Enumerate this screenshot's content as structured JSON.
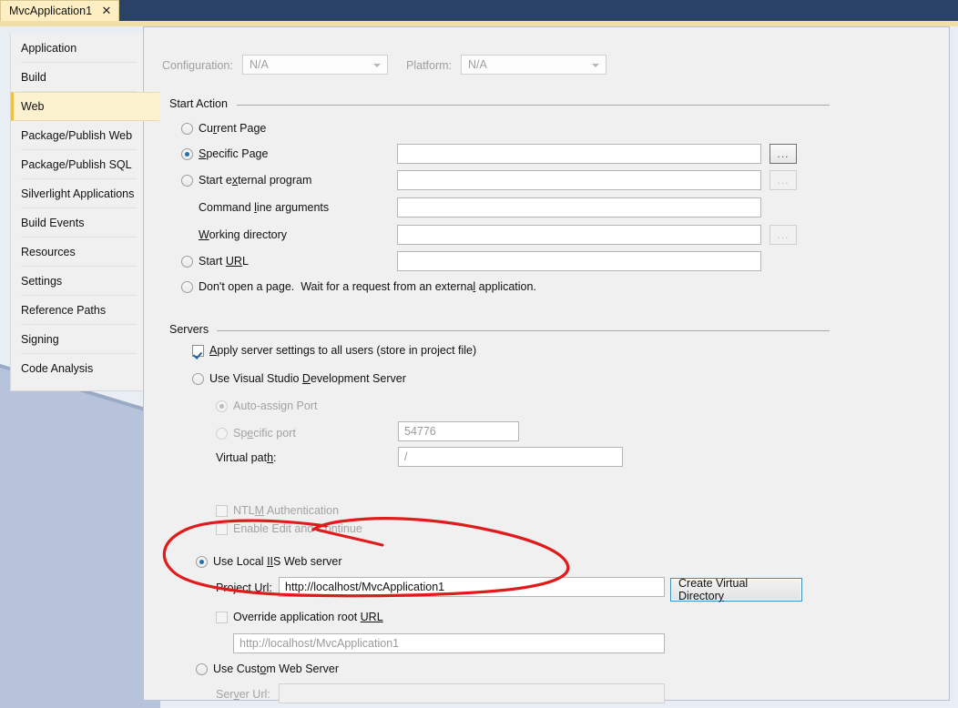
{
  "window": {
    "tab_label": "MvcApplication1",
    "close_icon": "close-icon",
    "accent_tab_bg": "#fdeec3",
    "titlebar_bg": "#2b4268"
  },
  "sidebar": {
    "items": [
      {
        "label": "Application",
        "selected": false
      },
      {
        "label": "Build",
        "selected": false
      },
      {
        "label": "Web",
        "selected": true
      },
      {
        "label": "Package/Publish Web",
        "selected": false
      },
      {
        "label": "Package/Publish SQL",
        "selected": false
      },
      {
        "label": "Silverlight Applications",
        "selected": false
      },
      {
        "label": "Build Events",
        "selected": false
      },
      {
        "label": "Resources",
        "selected": false
      },
      {
        "label": "Settings",
        "selected": false
      },
      {
        "label": "Reference Paths",
        "selected": false
      },
      {
        "label": "Signing",
        "selected": false
      },
      {
        "label": "Code Analysis",
        "selected": false
      }
    ]
  },
  "config_bar": {
    "configuration_label": "Configuration:",
    "configuration_value": "N/A",
    "platform_label": "Platform:",
    "platform_value": "N/A",
    "dropdown_icon": "chevron-down-icon"
  },
  "start_action": {
    "group_title": "Start Action",
    "options": [
      {
        "id": "current-page",
        "label": "Current Page",
        "mnemonic": "r",
        "selected": false,
        "disabled": false
      },
      {
        "id": "specific-page",
        "label": "Specific Page",
        "mnemonic": "S",
        "selected": true,
        "disabled": false
      },
      {
        "id": "start-external-program",
        "label": "Start external program",
        "mnemonic": "x",
        "selected": false,
        "disabled": false
      },
      {
        "id": "start-url",
        "label": "Start URL",
        "mnemonic": "R",
        "selected": false,
        "disabled": false
      },
      {
        "id": "dont-open-page",
        "label": "Don't open a page.  Wait for a request from an external application.",
        "mnemonic": "l",
        "selected": false,
        "disabled": false
      }
    ],
    "specific_page_value": "",
    "external_program_value": "",
    "command_line_label": "Command line arguments",
    "command_line_value": "",
    "working_directory_label": "Working directory",
    "working_directory_value": "",
    "start_url_value": "",
    "browse_label": "...",
    "browse_icon": "ellipsis-icon"
  },
  "servers": {
    "group_title": "Servers",
    "apply_all_users_label": "Apply server settings to all users (store in project file)",
    "apply_all_users_checked": true,
    "vs_dev_server_label": "Use Visual Studio Development Server",
    "vs_dev_server_selected": false,
    "auto_assign_port_label": "Auto-assign Port",
    "auto_assign_port_selected": true,
    "specific_port_label": "Specific port",
    "specific_port_selected": false,
    "specific_port_value": "54776",
    "virtual_path_label": "Virtual path:",
    "virtual_path_value": "/",
    "ntlm_label": "NTLM Authentication",
    "ntlm_checked": false,
    "edit_continue_label": "Enable Edit and Continue",
    "edit_continue_checked": false,
    "local_iis_label": "Use Local IIS Web server",
    "local_iis_selected": true,
    "project_url_label": "Project Url:",
    "project_url_value": "http://localhost/MvcApplication1",
    "create_virtual_directory_label": "Create Virtual Directory",
    "override_root_url_label": "Override application root URL",
    "override_root_url_checked": false,
    "override_root_url_value": "http://localhost/MvcApplication1",
    "custom_server_label": "Use Custom Web Server",
    "custom_server_selected": false,
    "server_url_label": "Server Url:",
    "server_url_value": ""
  },
  "annotation": {
    "color": "#e01b1b",
    "shape": "hand-drawn-ellipse",
    "targets": "Use Local IIS Web server / Project Url / Override application root URL"
  }
}
